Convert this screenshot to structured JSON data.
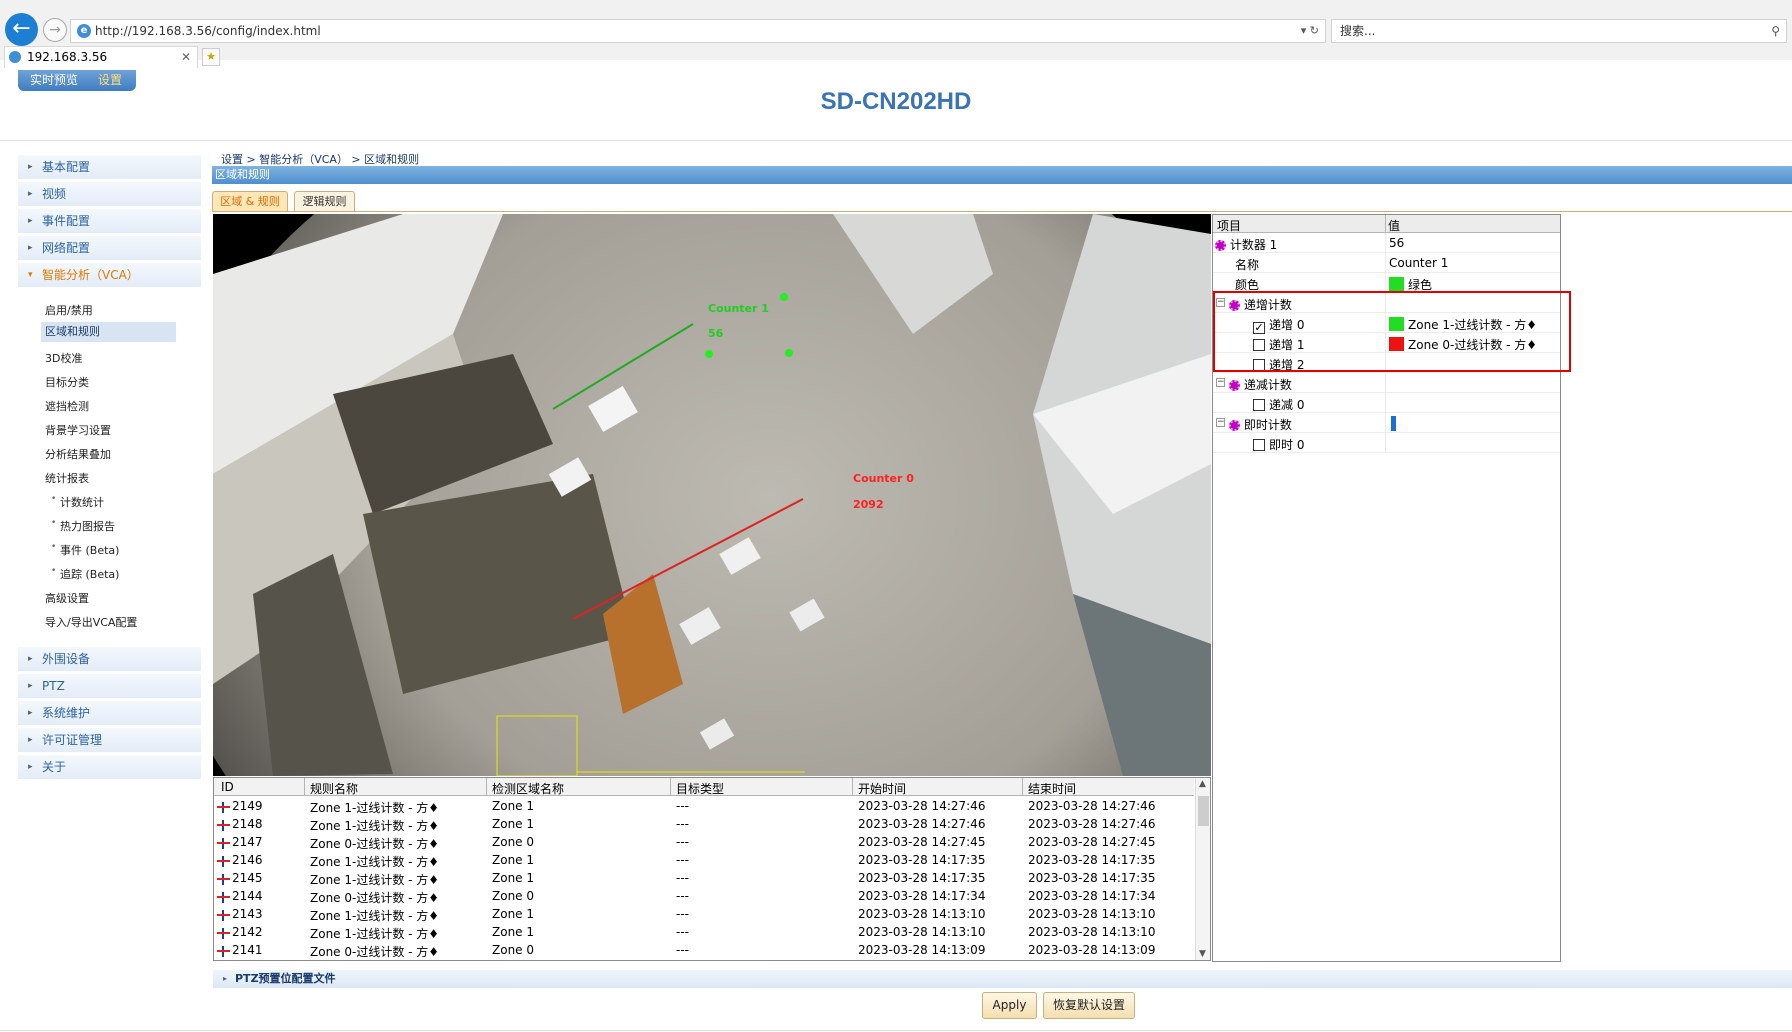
{
  "browser": {
    "url": "http://192.168.3.56/config/index.html",
    "search_placeholder": "搜索...",
    "tab_title": "192.168.3.56"
  },
  "header": {
    "mode_live": "实时预览",
    "mode_settings": "设置",
    "model": "SD-CN202HD"
  },
  "nav": {
    "items": [
      {
        "label": "基本配置"
      },
      {
        "label": "视频"
      },
      {
        "label": "事件配置"
      },
      {
        "label": "网络配置"
      },
      {
        "label": "智能分析（VCA）"
      }
    ],
    "vca_sub": [
      "启用/禁用",
      "区域和规则",
      "3D校准",
      "目标分类",
      "遮挡检测",
      "背景学习设置",
      "分析结果叠加",
      "统计报表"
    ],
    "stats_sub": [
      "计数统计",
      "热力图报告",
      "事件 (Beta)",
      "追踪 (Beta)"
    ],
    "vca_sub2": [
      "高级设置",
      "导入/导出VCA配置"
    ],
    "items2": [
      {
        "label": "外围设备"
      },
      {
        "label": "PTZ"
      },
      {
        "label": "系统维护"
      },
      {
        "label": "许可证管理"
      },
      {
        "label": "关于"
      }
    ]
  },
  "breadcrumb": "设置 > 智能分析（VCA） > 区域和规则",
  "section_title": "区域和规则",
  "subtabs": [
    "区域 & 规则",
    "逻辑规则"
  ],
  "video": {
    "counter1_label": "Counter 1",
    "counter1_value": "56",
    "counter0_label": "Counter 0",
    "counter0_value": "2092",
    "colors": {
      "counter1": "#22cc22",
      "counter0": "#ff2020",
      "zone": "#e8e800"
    }
  },
  "properties": {
    "col_item": "项目",
    "col_value": "值",
    "counter_name": "计数器 1",
    "counter_value": "56",
    "name_label": "名称",
    "name_value": "Counter 1",
    "color_label": "颜色",
    "color_value": "绿色",
    "inc_group": "递增计数",
    "inc": [
      {
        "label": "递增 0",
        "checked": true,
        "value": "Zone 1-过线计数 - 方♦",
        "color": "#22dd22"
      },
      {
        "label": "递增 1",
        "checked": false,
        "value": "Zone 0-过线计数 - 方♦",
        "color": "#ee1111"
      },
      {
        "label": "递增 2",
        "checked": false,
        "value": ""
      }
    ],
    "dec_group": "递减计数",
    "dec": [
      {
        "label": "递减 0",
        "checked": false
      }
    ],
    "inst_group": "即时计数",
    "inst": [
      {
        "label": "即时 0",
        "checked": false
      }
    ]
  },
  "events": {
    "columns": [
      "ID",
      "规则名称",
      "检测区域名称",
      "目标类型",
      "开始时间",
      "结束时间"
    ],
    "rows": [
      [
        "2149",
        "Zone 1-过线计数 - 方♦",
        "Zone 1",
        "---",
        "2023-03-28 14:27:46",
        "2023-03-28 14:27:46"
      ],
      [
        "2148",
        "Zone 1-过线计数 - 方♦",
        "Zone 1",
        "---",
        "2023-03-28 14:27:46",
        "2023-03-28 14:27:46"
      ],
      [
        "2147",
        "Zone 0-过线计数 - 方♦",
        "Zone 0",
        "---",
        "2023-03-28 14:27:45",
        "2023-03-28 14:27:45"
      ],
      [
        "2146",
        "Zone 1-过线计数 - 方♦",
        "Zone 1",
        "---",
        "2023-03-28 14:17:35",
        "2023-03-28 14:17:35"
      ],
      [
        "2145",
        "Zone 1-过线计数 - 方♦",
        "Zone 1",
        "---",
        "2023-03-28 14:17:35",
        "2023-03-28 14:17:35"
      ],
      [
        "2144",
        "Zone 0-过线计数 - 方♦",
        "Zone 0",
        "---",
        "2023-03-28 14:17:34",
        "2023-03-28 14:17:34"
      ],
      [
        "2143",
        "Zone 1-过线计数 - 方♦",
        "Zone 1",
        "---",
        "2023-03-28 14:13:10",
        "2023-03-28 14:13:10"
      ],
      [
        "2142",
        "Zone 1-过线计数 - 方♦",
        "Zone 1",
        "---",
        "2023-03-28 14:13:10",
        "2023-03-28 14:13:10"
      ],
      [
        "2141",
        "Zone 0-过线计数 - 方♦",
        "Zone 0",
        "---",
        "2023-03-28 14:13:09",
        "2023-03-28 14:13:09"
      ]
    ]
  },
  "ptz_section": "PTZ预置位配置文件",
  "buttons": {
    "apply": "Apply",
    "restore": "恢复默认设置"
  }
}
